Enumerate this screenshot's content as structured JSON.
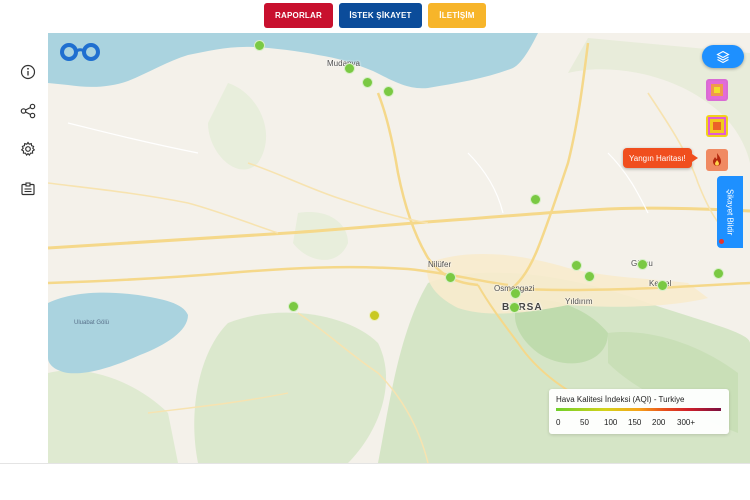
{
  "header": {
    "buttons": [
      {
        "label": "RAPORLAR",
        "color": "#c8102e"
      },
      {
        "label": "İSTEK ŞİKAYET",
        "color": "#0b4c9a"
      },
      {
        "label": "İLETİŞİM",
        "color": "#f7b52a"
      }
    ]
  },
  "sidebar": {
    "icons": [
      "info-icon",
      "share-icon",
      "gear-icon",
      "id-card-icon"
    ]
  },
  "map": {
    "logo_icon": "binoculars-logo-icon",
    "layers_icon": "layers-icon",
    "fire_label": "Yangın Haritası!",
    "complaint_label": "Şikayet Bildir",
    "cities": [
      {
        "name": "Mudanya"
      },
      {
        "name": "Nilüfer"
      },
      {
        "name": "Osmangazi"
      },
      {
        "name": "BURSA"
      },
      {
        "name": "Yıldırım"
      },
      {
        "name": "Gürsu"
      },
      {
        "name": "Kestel"
      }
    ],
    "lake_label": "Uluabat Gölü",
    "stations": [
      {
        "aqi_level": "good",
        "color": "#7ac943"
      },
      {
        "aqi_level": "good",
        "color": "#7ac943"
      },
      {
        "aqi_level": "good",
        "color": "#7ac943"
      },
      {
        "aqi_level": "good",
        "color": "#7ac943"
      },
      {
        "aqi_level": "good",
        "color": "#7ac943"
      },
      {
        "aqi_level": "good",
        "color": "#7ac943"
      },
      {
        "aqi_level": "good",
        "color": "#7ac943"
      },
      {
        "aqi_level": "good",
        "color": "#7ac943"
      },
      {
        "aqi_level": "good",
        "color": "#7ac943"
      },
      {
        "aqi_level": "good",
        "color": "#7ac943"
      },
      {
        "aqi_level": "good",
        "color": "#7ac943"
      },
      {
        "aqi_level": "good",
        "color": "#7ac943"
      },
      {
        "aqi_level": "good",
        "color": "#7ac943"
      },
      {
        "aqi_level": "good",
        "color": "#7ac943"
      },
      {
        "aqi_level": "moderate",
        "color": "#c9c922"
      }
    ]
  },
  "legend": {
    "title": "Hava Kalitesi İndeksi (AQI) - Turkiye",
    "ticks": [
      "0",
      "50",
      "100",
      "150",
      "200",
      "300+"
    ]
  }
}
